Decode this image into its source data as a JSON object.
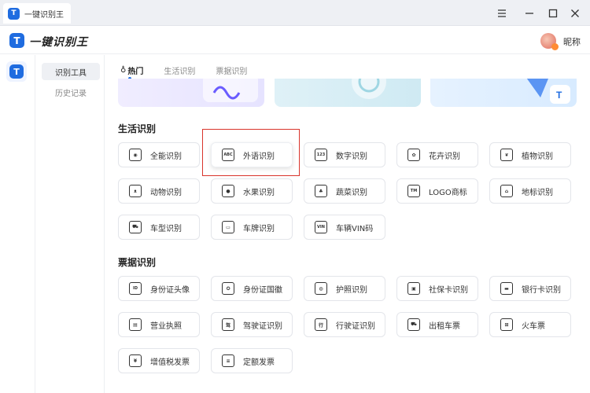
{
  "window": {
    "tab_title": "一键识别王",
    "logo_letter": "T"
  },
  "header": {
    "app_title": "一键识别王",
    "nickname": "昵称"
  },
  "subnav": {
    "items": [
      {
        "label": "识别工具",
        "active": true
      },
      {
        "label": "历史记录",
        "active": false
      }
    ]
  },
  "tabs": [
    {
      "label": "热门",
      "active": true,
      "icon": "flame-icon"
    },
    {
      "label": "生活识别",
      "active": false
    },
    {
      "label": "票据识别",
      "active": false
    }
  ],
  "sections": {
    "life": {
      "title": "生活识别",
      "items": [
        {
          "label": "全能识别",
          "icon": "eye-icon",
          "glyph": "◉"
        },
        {
          "label": "外语识别",
          "icon": "abc-icon",
          "glyph": "ABC"
        },
        {
          "label": "数字识别",
          "icon": "123-icon",
          "glyph": "123"
        },
        {
          "label": "花卉识别",
          "icon": "flower-icon",
          "glyph": "✿"
        },
        {
          "label": "植物识别",
          "icon": "plant-icon",
          "glyph": "❦"
        },
        {
          "label": "动物识别",
          "icon": "animal-icon",
          "glyph": "ᴥ"
        },
        {
          "label": "水果识别",
          "icon": "fruit-icon",
          "glyph": "●"
        },
        {
          "label": "蔬菜识别",
          "icon": "vegetable-icon",
          "glyph": "♣"
        },
        {
          "label": "LOGO商标",
          "icon": "logo-icon",
          "glyph": "TM"
        },
        {
          "label": "地标识别",
          "icon": "landmark-icon",
          "glyph": "⌂"
        },
        {
          "label": "车型识别",
          "icon": "car-icon",
          "glyph": "⛟"
        },
        {
          "label": "车牌识别",
          "icon": "license-plate-icon",
          "glyph": "▭"
        },
        {
          "label": "车辆VIN码",
          "icon": "vin-icon",
          "glyph": "VIN"
        }
      ]
    },
    "bills": {
      "title": "票据识别",
      "items": [
        {
          "label": "身份证头像",
          "icon": "id-front-icon",
          "glyph": "ID"
        },
        {
          "label": "身份证国徽",
          "icon": "id-back-icon",
          "glyph": "✪"
        },
        {
          "label": "护照识别",
          "icon": "passport-icon",
          "glyph": "◍"
        },
        {
          "label": "社保卡识别",
          "icon": "social-card-icon",
          "glyph": "▣"
        },
        {
          "label": "银行卡识别",
          "icon": "bank-card-icon",
          "glyph": "▬"
        },
        {
          "label": "营业执照",
          "icon": "business-license-icon",
          "glyph": "▤"
        },
        {
          "label": "驾驶证识别",
          "icon": "driver-license-icon",
          "glyph": "驾"
        },
        {
          "label": "行驶证识别",
          "icon": "vehicle-license-icon",
          "glyph": "行"
        },
        {
          "label": "出租车票",
          "icon": "taxi-icon",
          "glyph": "⛟"
        },
        {
          "label": "火车票",
          "icon": "train-icon",
          "glyph": "⊞"
        },
        {
          "label": "增值税发票",
          "icon": "vat-invoice-icon",
          "glyph": "¥"
        },
        {
          "label": "定额发票",
          "icon": "fixed-invoice-icon",
          "glyph": "≡"
        }
      ]
    }
  },
  "colors": {
    "brand": "#1f6ce0",
    "highlight_border": "#d9342b"
  }
}
